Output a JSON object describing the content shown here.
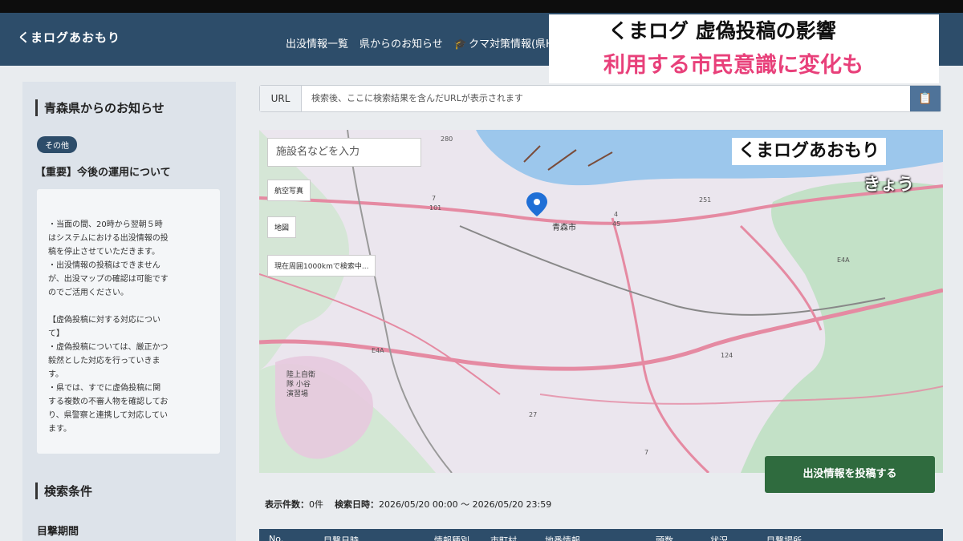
{
  "app": {
    "brand": "くまログあおもり"
  },
  "nav": {
    "items": [
      "出没情報一覧",
      "県からのお知らせ",
      "クマ対策情報(県HP)"
    ]
  },
  "sidebar": {
    "title": "青森県からのお知らせ",
    "tag": "その他",
    "notice_title": "【重要】今後の運用について",
    "notice_body": [
      "・当面の間、20時から翌朝５時\nはシステムにおける出没情報の投\n稿を停止させていただきます。",
      "・出没情報の投稿はできません\nが、出没マップの確認は可能です\nのでご活用ください。",
      "【虚偽投稿に対する対応につい\nて】",
      "・虚偽投稿については、厳正かつ\n毅然とした対応を行っていきま\nす。",
      "・県では、すでに虚偽投稿に関\nする複数の不審人物を確認してお\nり、県警察と連携して対応してい\nます。"
    ],
    "search_title": "検索条件",
    "period_label": "目撃期間"
  },
  "url": {
    "label": "URL",
    "placeholder": "検索後、ここに検索結果を含んだURLが表示されます"
  },
  "map": {
    "search_placeholder": "施設名などを入力",
    "buttons": [
      "航空写真",
      "地図"
    ],
    "status": "現在周囲1000kmで検索中...",
    "labels": {
      "city": "青森市",
      "base": "陸上自衛\n隊 小谷\n演習場",
      "routes": [
        "280",
        "7",
        "101",
        "4",
        "45",
        "251",
        "E4A",
        "E4A",
        "124",
        "7",
        "27"
      ]
    }
  },
  "post_button": "出没情報を投稿する",
  "results": {
    "count_label": "表示件数：",
    "count_value": "0件",
    "datetime_label": "検索日時：",
    "datetime_value": "2026/05/20 00:00 ～ 2026/05/20 23:59"
  },
  "table": {
    "columns": [
      "No.",
      "目撃日時",
      "情報種別",
      "市町村",
      "地番情報",
      "頭数",
      "状況",
      "目撃場所"
    ]
  },
  "overlay": {
    "headline1": "くまログ 虚偽投稿の影響",
    "headline2": "利用する市民意識に変化も",
    "source": "くまログあおもり",
    "date": "きょう"
  },
  "colors": {
    "header": "#2d4d6a",
    "post_button": "#2f6b3e",
    "headline_pink": "#e8407a",
    "pin": "#1f6fd6"
  }
}
